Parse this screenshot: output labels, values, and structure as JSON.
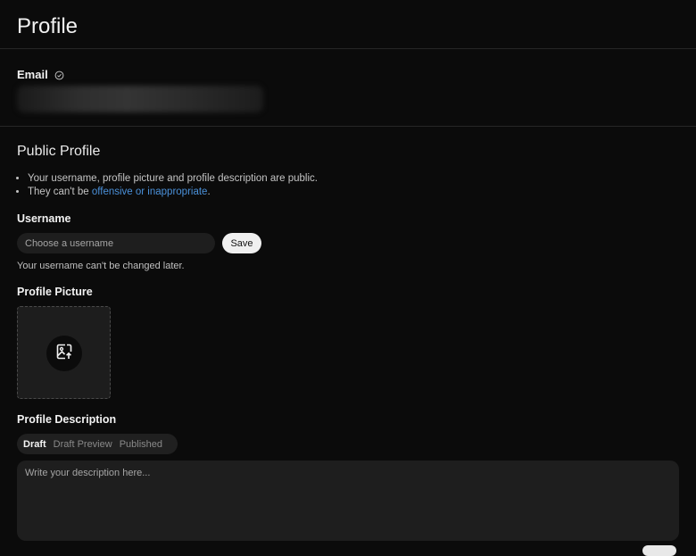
{
  "page": {
    "title": "Profile"
  },
  "email": {
    "label": "Email",
    "verified_icon": "check-circle-icon"
  },
  "public_profile": {
    "title": "Public Profile",
    "rule_1": "Your username, profile picture and profile description are public.",
    "rule_2_prefix": "They can't be ",
    "rule_2_link": "offensive or inappropriate",
    "rule_2_suffix": "."
  },
  "username": {
    "label": "Username",
    "placeholder": "Choose a username",
    "value": "",
    "save_label": "Save",
    "hint": "Your username can't be changed later."
  },
  "profile_picture": {
    "label": "Profile Picture",
    "icon": "image-upload-icon"
  },
  "profile_description": {
    "label": "Profile Description",
    "tabs": [
      {
        "label": "Draft",
        "active": true
      },
      {
        "label": "Draft Preview",
        "active": false
      },
      {
        "label": "Published",
        "active": false
      }
    ],
    "placeholder": "Write your description here...",
    "value": ""
  },
  "colors": {
    "background": "#0b0b0b",
    "field": "#1e1e1e",
    "link": "#4a90d9",
    "button": "#f0f0f0"
  }
}
